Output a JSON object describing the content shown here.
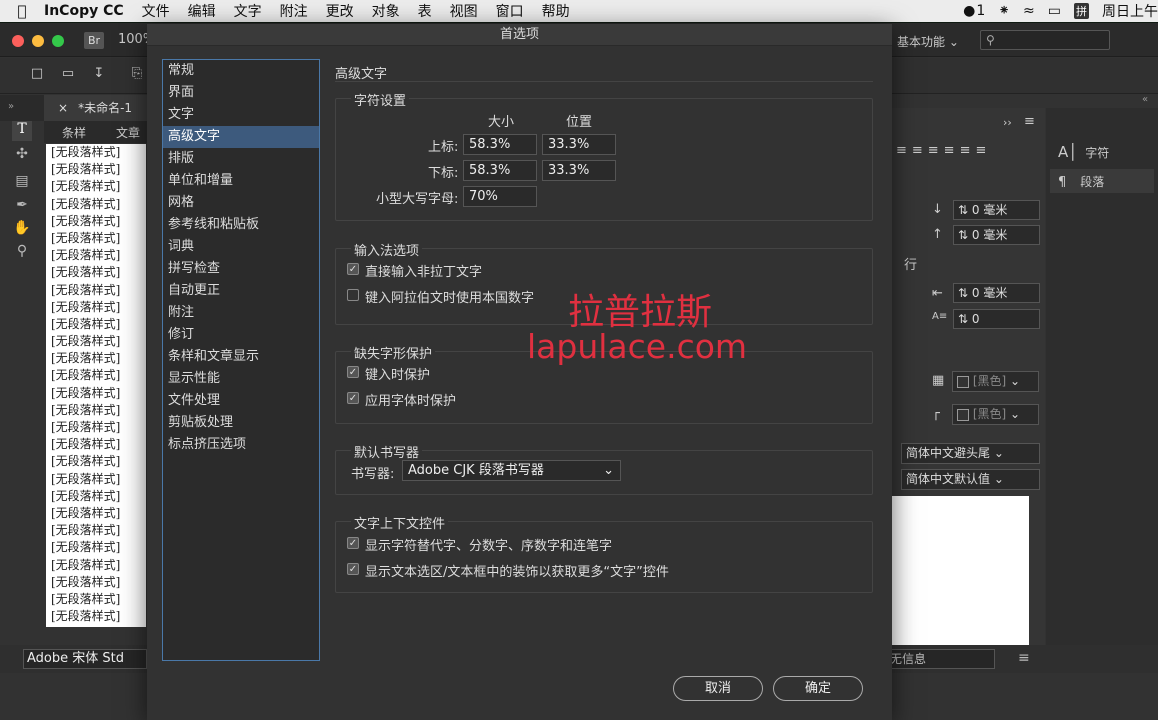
{
  "menubar": {
    "app": "InCopy CC",
    "items": [
      "文件",
      "编辑",
      "文字",
      "附注",
      "更改",
      "对象",
      "表",
      "视图",
      "窗口",
      "帮助"
    ],
    "clock": "周日上午",
    "user_count": "1",
    "input_method": "拼"
  },
  "app": {
    "zoom": "100%",
    "br_badge": "Br",
    "workspace": "基本功能",
    "doc_tab": "*未命名-1",
    "subtabs": [
      "条样",
      "文章"
    ],
    "galley_lines": [
      "[无段落样式]",
      "[无段落样式]",
      "[无段落样式]",
      "[无段落样式]",
      "[无段落样式]",
      "[无段落样式]",
      "[无段落样式]",
      "[无段落样式]",
      "[无段落样式]",
      "[无段落样式]",
      "[无段落样式]",
      "[无段落样式]",
      "[无段落样式]",
      "[无段落样式]",
      "[无段落样式]",
      "[无段落样式]",
      "[无段落样式]",
      "[无段落样式]",
      "[无段落样式]",
      "[无段落样式]",
      "[无段落样式]",
      "[无段落样式]",
      "[无段落样式]",
      "[无段落样式]",
      "[无段落样式]",
      "[无段落样式]",
      "[无段落样式]",
      "[无段落样式]"
    ],
    "font_field": "Adobe 宋体 Std",
    "info_field": "无信息"
  },
  "panels": {
    "side_items": [
      {
        "icon": "character-icon",
        "label": "字符"
      },
      {
        "icon": "paragraph-icon",
        "label": "段落"
      }
    ],
    "space_after": "0 毫米",
    "space_before": "0 毫米",
    "lines_label": "行",
    "indent_value": "0 毫米",
    "drop_value": "0",
    "color1": "[黑色]",
    "color2": "[黑色]",
    "kinsoku": "简体中文避头尾",
    "mojikumi": "简体中文默认值"
  },
  "dialog": {
    "title": "首选项",
    "categories": [
      "常规",
      "界面",
      "文字",
      "高级文字",
      "排版",
      "单位和增量",
      "网格",
      "参考线和粘贴板",
      "词典",
      "拼写检查",
      "自动更正",
      "附注",
      "修订",
      "条样和文章显示",
      "显示性能",
      "文件处理",
      "剪贴板处理",
      "标点挤压选项"
    ],
    "selected_index": 3,
    "section_title": "高级文字",
    "char_settings": {
      "title": "字符设置",
      "col_size": "大小",
      "col_pos": "位置",
      "superscript_label": "上标:",
      "superscript_size": "58.3%",
      "superscript_pos": "33.3%",
      "subscript_label": "下标:",
      "subscript_size": "58.3%",
      "subscript_pos": "33.3%",
      "smallcaps_label": "小型大写字母:",
      "smallcaps_value": "70%"
    },
    "ime": {
      "title": "输入法选项",
      "opt1": "直接输入非拉丁文字",
      "opt2": "键入阿拉伯文时使用本国数字"
    },
    "missing": {
      "title": "缺失字形保护",
      "opt1": "键入时保护",
      "opt2": "应用字体时保护"
    },
    "composer": {
      "title": "默认书写器",
      "label": "书写器:",
      "value": "Adobe CJK 段落书写器"
    },
    "context": {
      "title": "文字上下文控件",
      "opt1": "显示字符替代字、分数字、序数字和连笔字",
      "opt2": "显示文本选区/文本框中的装饰以获取更多“文字”控件"
    },
    "cancel": "取消",
    "ok": "确定"
  },
  "watermark": {
    "line1": "拉普拉斯",
    "line2": "lapulace.com"
  }
}
